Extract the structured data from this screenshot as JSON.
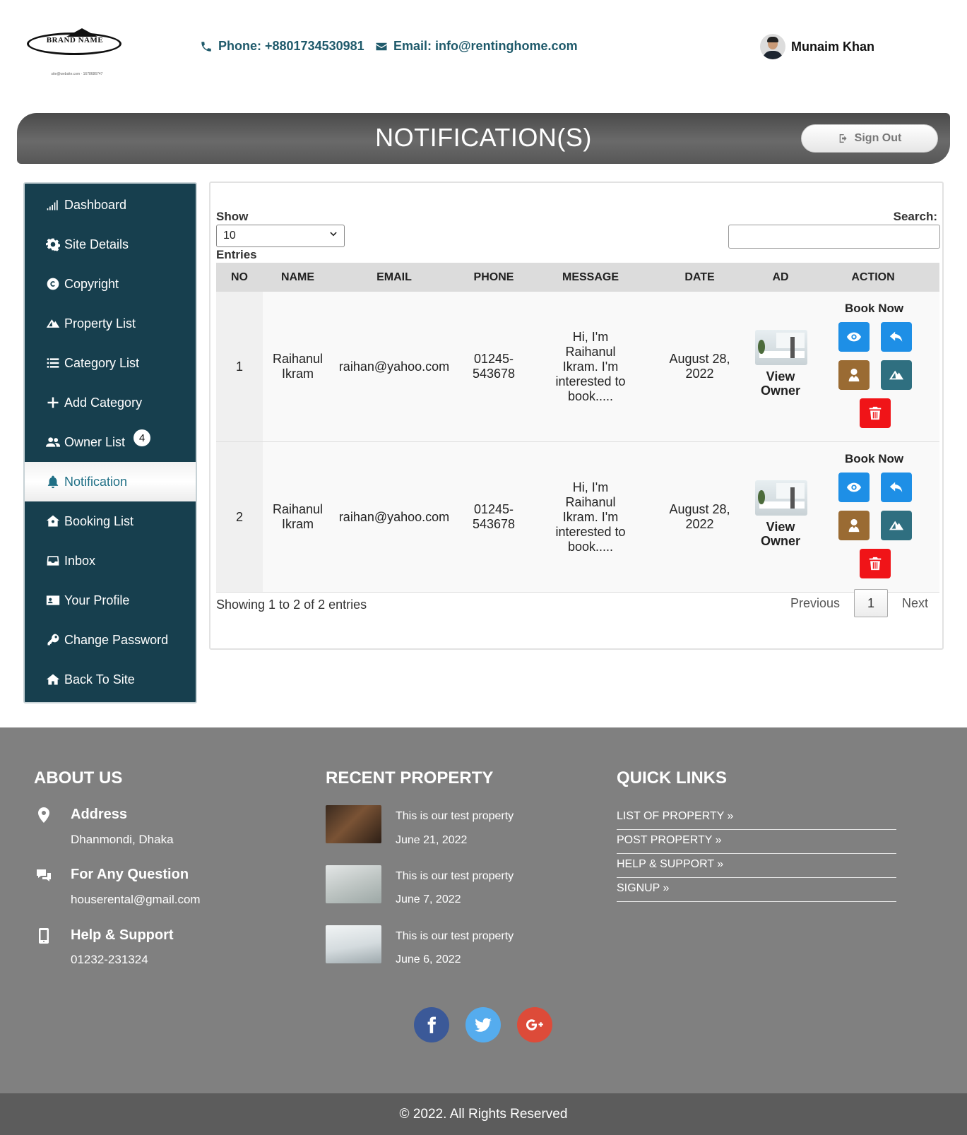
{
  "header": {
    "brand_name": "BRAND NAME",
    "brand_tagline": "site@website.com · 1678686747",
    "phone": "Phone: +8801734530981",
    "email": "Email: info@rentinghome.com",
    "user_name": "Munaim Khan"
  },
  "banner": {
    "title": "NOTIFICATION(S)",
    "signout_label": "Sign Out"
  },
  "sidebar": {
    "items": [
      {
        "label": "Dashboard",
        "icon": "signal-bars-icon"
      },
      {
        "label": "Site Details",
        "icon": "gear-icon"
      },
      {
        "label": "Copyright",
        "icon": "copyright-icon"
      },
      {
        "label": "Property List",
        "icon": "mountain-icon"
      },
      {
        "label": "Category List",
        "icon": "list-icon"
      },
      {
        "label": "Add Category",
        "icon": "plus-icon"
      },
      {
        "label": "Owner List",
        "icon": "users-icon",
        "badge": "4"
      },
      {
        "label": "Notification",
        "icon": "bell-icon",
        "active": true
      },
      {
        "label": "Booking List",
        "icon": "house-user-icon"
      },
      {
        "label": "Inbox",
        "icon": "inbox-icon"
      },
      {
        "label": "Your Profile",
        "icon": "id-card-icon"
      },
      {
        "label": "Change Password",
        "icon": "key-icon"
      },
      {
        "label": "Back To Site",
        "icon": "back-arrow-icon"
      }
    ]
  },
  "table": {
    "show_label": "Show",
    "show_value": "10",
    "entries_label": "Entries",
    "search_label": "Search:",
    "search_value": "",
    "columns": [
      "NO",
      "NAME",
      "EMAIL",
      "PHONE",
      "MESSAGE",
      "DATE",
      "AD",
      "ACTION"
    ],
    "rows": [
      {
        "no": "1",
        "name": "Raihanul Ikram",
        "email": "raihan@yahoo.com",
        "phone": "01245-543678",
        "message": "Hi, I'm Raihanul Ikram. I'm interested to book.....",
        "date": "August 28, 2022",
        "ad_link": "View Owner",
        "book_now": "Book Now"
      },
      {
        "no": "2",
        "name": "Raihanul Ikram",
        "email": "raihan@yahoo.com",
        "phone": "01245-543678",
        "message": "Hi, I'm Raihanul Ikram. I'm interested to book.....",
        "date": "August 28, 2022",
        "ad_link": "View Owner",
        "book_now": "Book Now"
      }
    ],
    "info": "Showing 1 to 2 of 2 entries",
    "pager": {
      "prev": "Previous",
      "current": "1",
      "next": "Next"
    }
  },
  "footer": {
    "about": {
      "heading": "ABOUT US",
      "address_title": "Address",
      "address_value": "Dhanmondi, Dhaka",
      "question_title": "For Any Question",
      "question_value": "houserental@gmail.com",
      "help_title": "Help & Support",
      "help_value": "01232-231324"
    },
    "recent": {
      "heading": "RECENT PROPERTY",
      "items": [
        {
          "title": "This is our test property",
          "date": "June 21, 2022"
        },
        {
          "title": "This is our test property",
          "date": "June 7, 2022"
        },
        {
          "title": "This is our test property",
          "date": "June 6, 2022"
        }
      ]
    },
    "links": {
      "heading": "QUICK LINKS",
      "items": [
        "LIST OF PROPERTY »",
        "POST PROPERTY »",
        "HELP & SUPPORT »",
        "SIGNUP »"
      ]
    },
    "social": [
      "facebook-icon",
      "twitter-icon",
      "google-plus-icon"
    ],
    "copyright": "© 2022. All Rights Reserved"
  },
  "colors": {
    "sidebar_bg": "#173f4e",
    "accent_teal": "#1f5a6b",
    "btn_blue": "#1e8fe6",
    "btn_brown": "#9a6b33",
    "btn_teal": "#2f6f80",
    "btn_red": "#f01418",
    "footer_bg": "#808080",
    "facebook": "#3b5998",
    "twitter": "#55acee",
    "google_plus": "#dd4b39"
  }
}
